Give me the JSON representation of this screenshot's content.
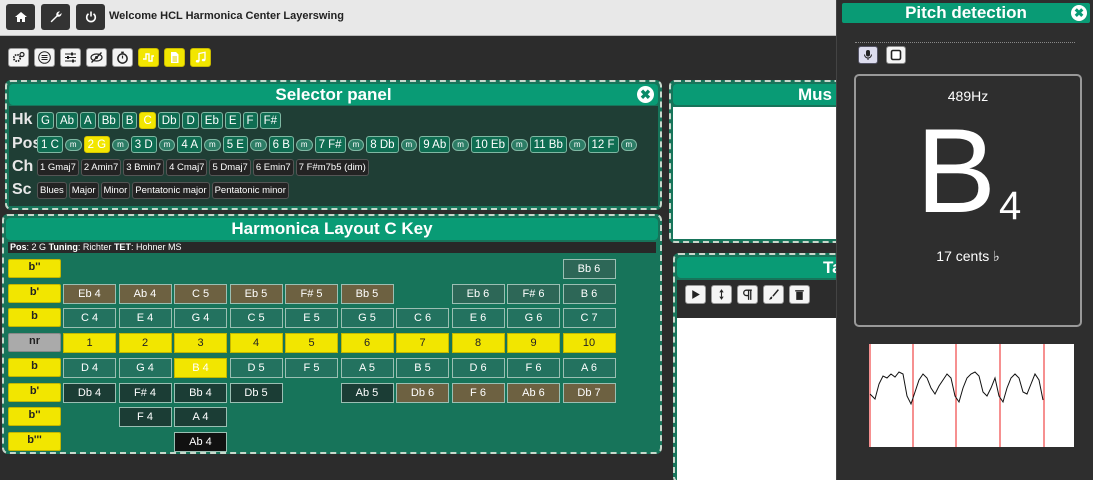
{
  "header": {
    "welcome": "Welcome HCL Harmonica Center Layerswing",
    "buttons": [
      {
        "icon": "home-icon"
      },
      {
        "icon": "wrench-icon"
      },
      {
        "icon": "power-icon"
      }
    ]
  },
  "toolbar": {
    "buttons": [
      {
        "icon": "gears-icon",
        "style": "white"
      },
      {
        "icon": "menu-icon",
        "style": "white"
      },
      {
        "icon": "sliders-icon",
        "style": "white"
      },
      {
        "icon": "eye-slash-icon",
        "style": "white"
      },
      {
        "icon": "stopwatch-icon",
        "style": "white"
      },
      {
        "icon": "wave-icon",
        "style": "yellow"
      },
      {
        "icon": "document-icon",
        "style": "yellow"
      },
      {
        "icon": "music-note-icon",
        "style": "yellow"
      }
    ]
  },
  "selector": {
    "title": "Selector panel",
    "close": "✖",
    "hk_label": "Hk",
    "keys": [
      "G",
      "Ab",
      "A",
      "Bb",
      "B",
      "C",
      "Db",
      "D",
      "Eb",
      "E",
      "F",
      "F#"
    ],
    "selected_key": "C",
    "pos_label": "Pos",
    "positions": [
      "1 C",
      "2 G",
      "3 D",
      "4 A",
      "5 E",
      "6 B",
      "7 F#",
      "8 Db",
      "9 Ab",
      "10 Eb",
      "11 Bb",
      "12 F"
    ],
    "selected_position": "2 G",
    "m_label": "m",
    "ch_label": "Ch",
    "chords": [
      "1 Gmaj7",
      "2 Amin7",
      "3 Bmin7",
      "4 Cmaj7",
      "5 Dmaj7",
      "6 Emin7",
      "7 F#m7b5 (dim)"
    ],
    "sc_label": "Sc",
    "scales": [
      "Blues",
      "Major",
      "Minor",
      "Pentatonic major",
      "Pentatonic minor"
    ]
  },
  "layout": {
    "title": "Harmonica Layout C Key",
    "info": {
      "pos_label": "Pos",
      "pos": "2 G",
      "tuning_label": "Tuning",
      "tuning": "Richter",
      "tet_label": "TET",
      "tet": "Hohner MS"
    },
    "row_labels": [
      "b''",
      "b'",
      "b",
      "nr",
      "b",
      "b'",
      "b''",
      "b'''"
    ],
    "rows": [
      [
        null,
        null,
        null,
        null,
        null,
        null,
        null,
        null,
        null,
        {
          "t": "Bb 6",
          "s": "mid"
        }
      ],
      [
        {
          "t": "Eb 4",
          "s": "brown"
        },
        {
          "t": "Ab 4",
          "s": "brown"
        },
        {
          "t": "C 5",
          "s": "brown"
        },
        {
          "t": "Eb 5",
          "s": "brown"
        },
        {
          "t": "F# 5",
          "s": "brown"
        },
        {
          "t": "Bb 5",
          "s": "brown"
        },
        null,
        {
          "t": "Eb 6",
          "s": "mid"
        },
        {
          "t": "F# 6",
          "s": "mid"
        },
        {
          "t": "B 6",
          "s": "mid"
        }
      ],
      [
        {
          "t": "C 4",
          "s": "teal"
        },
        {
          "t": "E 4",
          "s": "teal"
        },
        {
          "t": "G 4",
          "s": "teal"
        },
        {
          "t": "C 5",
          "s": "teal"
        },
        {
          "t": "E 5",
          "s": "teal"
        },
        {
          "t": "G 5",
          "s": "teal"
        },
        {
          "t": "C 6",
          "s": "teal"
        },
        {
          "t": "E 6",
          "s": "teal"
        },
        {
          "t": "G 6",
          "s": "teal"
        },
        {
          "t": "C 7",
          "s": "teal"
        }
      ],
      [
        {
          "t": "1",
          "s": "yellow"
        },
        {
          "t": "2",
          "s": "yellow"
        },
        {
          "t": "3",
          "s": "yellow"
        },
        {
          "t": "4",
          "s": "yellow"
        },
        {
          "t": "5",
          "s": "yellow"
        },
        {
          "t": "6",
          "s": "yellow"
        },
        {
          "t": "7",
          "s": "yellow"
        },
        {
          "t": "8",
          "s": "yellow"
        },
        {
          "t": "9",
          "s": "yellow"
        },
        {
          "t": "10",
          "s": "yellow"
        }
      ],
      [
        {
          "t": "D 4",
          "s": "teal"
        },
        {
          "t": "G 4",
          "s": "teal"
        },
        {
          "t": "B 4",
          "s": "hl"
        },
        {
          "t": "D 5",
          "s": "teal"
        },
        {
          "t": "F 5",
          "s": "teal"
        },
        {
          "t": "A 5",
          "s": "teal"
        },
        {
          "t": "B 5",
          "s": "teal"
        },
        {
          "t": "D 6",
          "s": "teal"
        },
        {
          "t": "F 6",
          "s": "teal"
        },
        {
          "t": "A 6",
          "s": "teal"
        }
      ],
      [
        {
          "t": "Db 4",
          "s": "dark"
        },
        {
          "t": "F# 4",
          "s": "dark"
        },
        {
          "t": "Bb 4",
          "s": "dark"
        },
        {
          "t": "Db 5",
          "s": "dark"
        },
        null,
        {
          "t": "Ab 5",
          "s": "dark"
        },
        {
          "t": "Db 6",
          "s": "brown"
        },
        {
          "t": "F 6",
          "s": "brown"
        },
        {
          "t": "Ab 6",
          "s": "brown"
        },
        {
          "t": "Db 7",
          "s": "brown"
        }
      ],
      [
        null,
        {
          "t": "F 4",
          "s": "dark"
        },
        {
          "t": "A 4",
          "s": "dark"
        },
        null,
        null,
        null,
        null,
        null,
        null,
        null
      ],
      [
        null,
        null,
        {
          "t": "Ab 4",
          "s": "black"
        },
        null,
        null,
        null,
        null,
        null,
        null,
        null
      ]
    ]
  },
  "music_panel": {
    "title": "Mus"
  },
  "tab_panel": {
    "title": "Ta",
    "buttons": [
      {
        "icon": "play-icon"
      },
      {
        "icon": "updown-icon"
      },
      {
        "icon": "pilcrow-icon"
      },
      {
        "icon": "brush-icon"
      },
      {
        "icon": "trash-icon"
      }
    ]
  },
  "pitch": {
    "title": "Pitch detection",
    "close": "✖",
    "frequency": "489Hz",
    "note": "B",
    "octave": "4",
    "cents": "17 cents ♭",
    "buttons": [
      {
        "icon": "microphone-icon"
      },
      {
        "icon": "stop-icon"
      }
    ]
  }
}
